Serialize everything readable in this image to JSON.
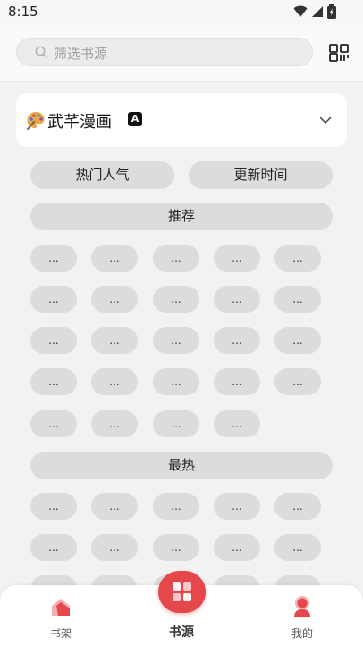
{
  "status_bar": {
    "time": "8:15"
  },
  "search": {
    "placeholder": "筛选书源"
  },
  "source": {
    "title": "武芊漫画",
    "badge": "A"
  },
  "sort_tabs": [
    "热门人气",
    "更新时间"
  ],
  "sections": [
    {
      "title": "推荐",
      "rows": [
        [
          "...",
          "...",
          "...",
          "...",
          "..."
        ],
        [
          "...",
          "...",
          "...",
          "...",
          "..."
        ],
        [
          "...",
          "...",
          "...",
          "...",
          "..."
        ],
        [
          "...",
          "...",
          "...",
          "...",
          "..."
        ],
        [
          "...",
          "...",
          "...",
          "..."
        ]
      ]
    },
    {
      "title": "最热",
      "rows": [
        [
          "...",
          "...",
          "...",
          "...",
          "..."
        ],
        [
          "...",
          "...",
          "...",
          "...",
          "..."
        ],
        [
          "...",
          "...",
          "...",
          "...",
          "..."
        ]
      ]
    }
  ],
  "nav": {
    "bookshelf": "书架",
    "sources": "书源",
    "mine": "我的"
  },
  "colors": {
    "accent": "#e4484b",
    "chip": "#dcdcdc",
    "background": "#f2f2f2"
  },
  "icons": {
    "search": "search-icon",
    "qr": "qr-code-icon",
    "chevron": "chevron-down-icon",
    "palette": "palette-icon"
  }
}
